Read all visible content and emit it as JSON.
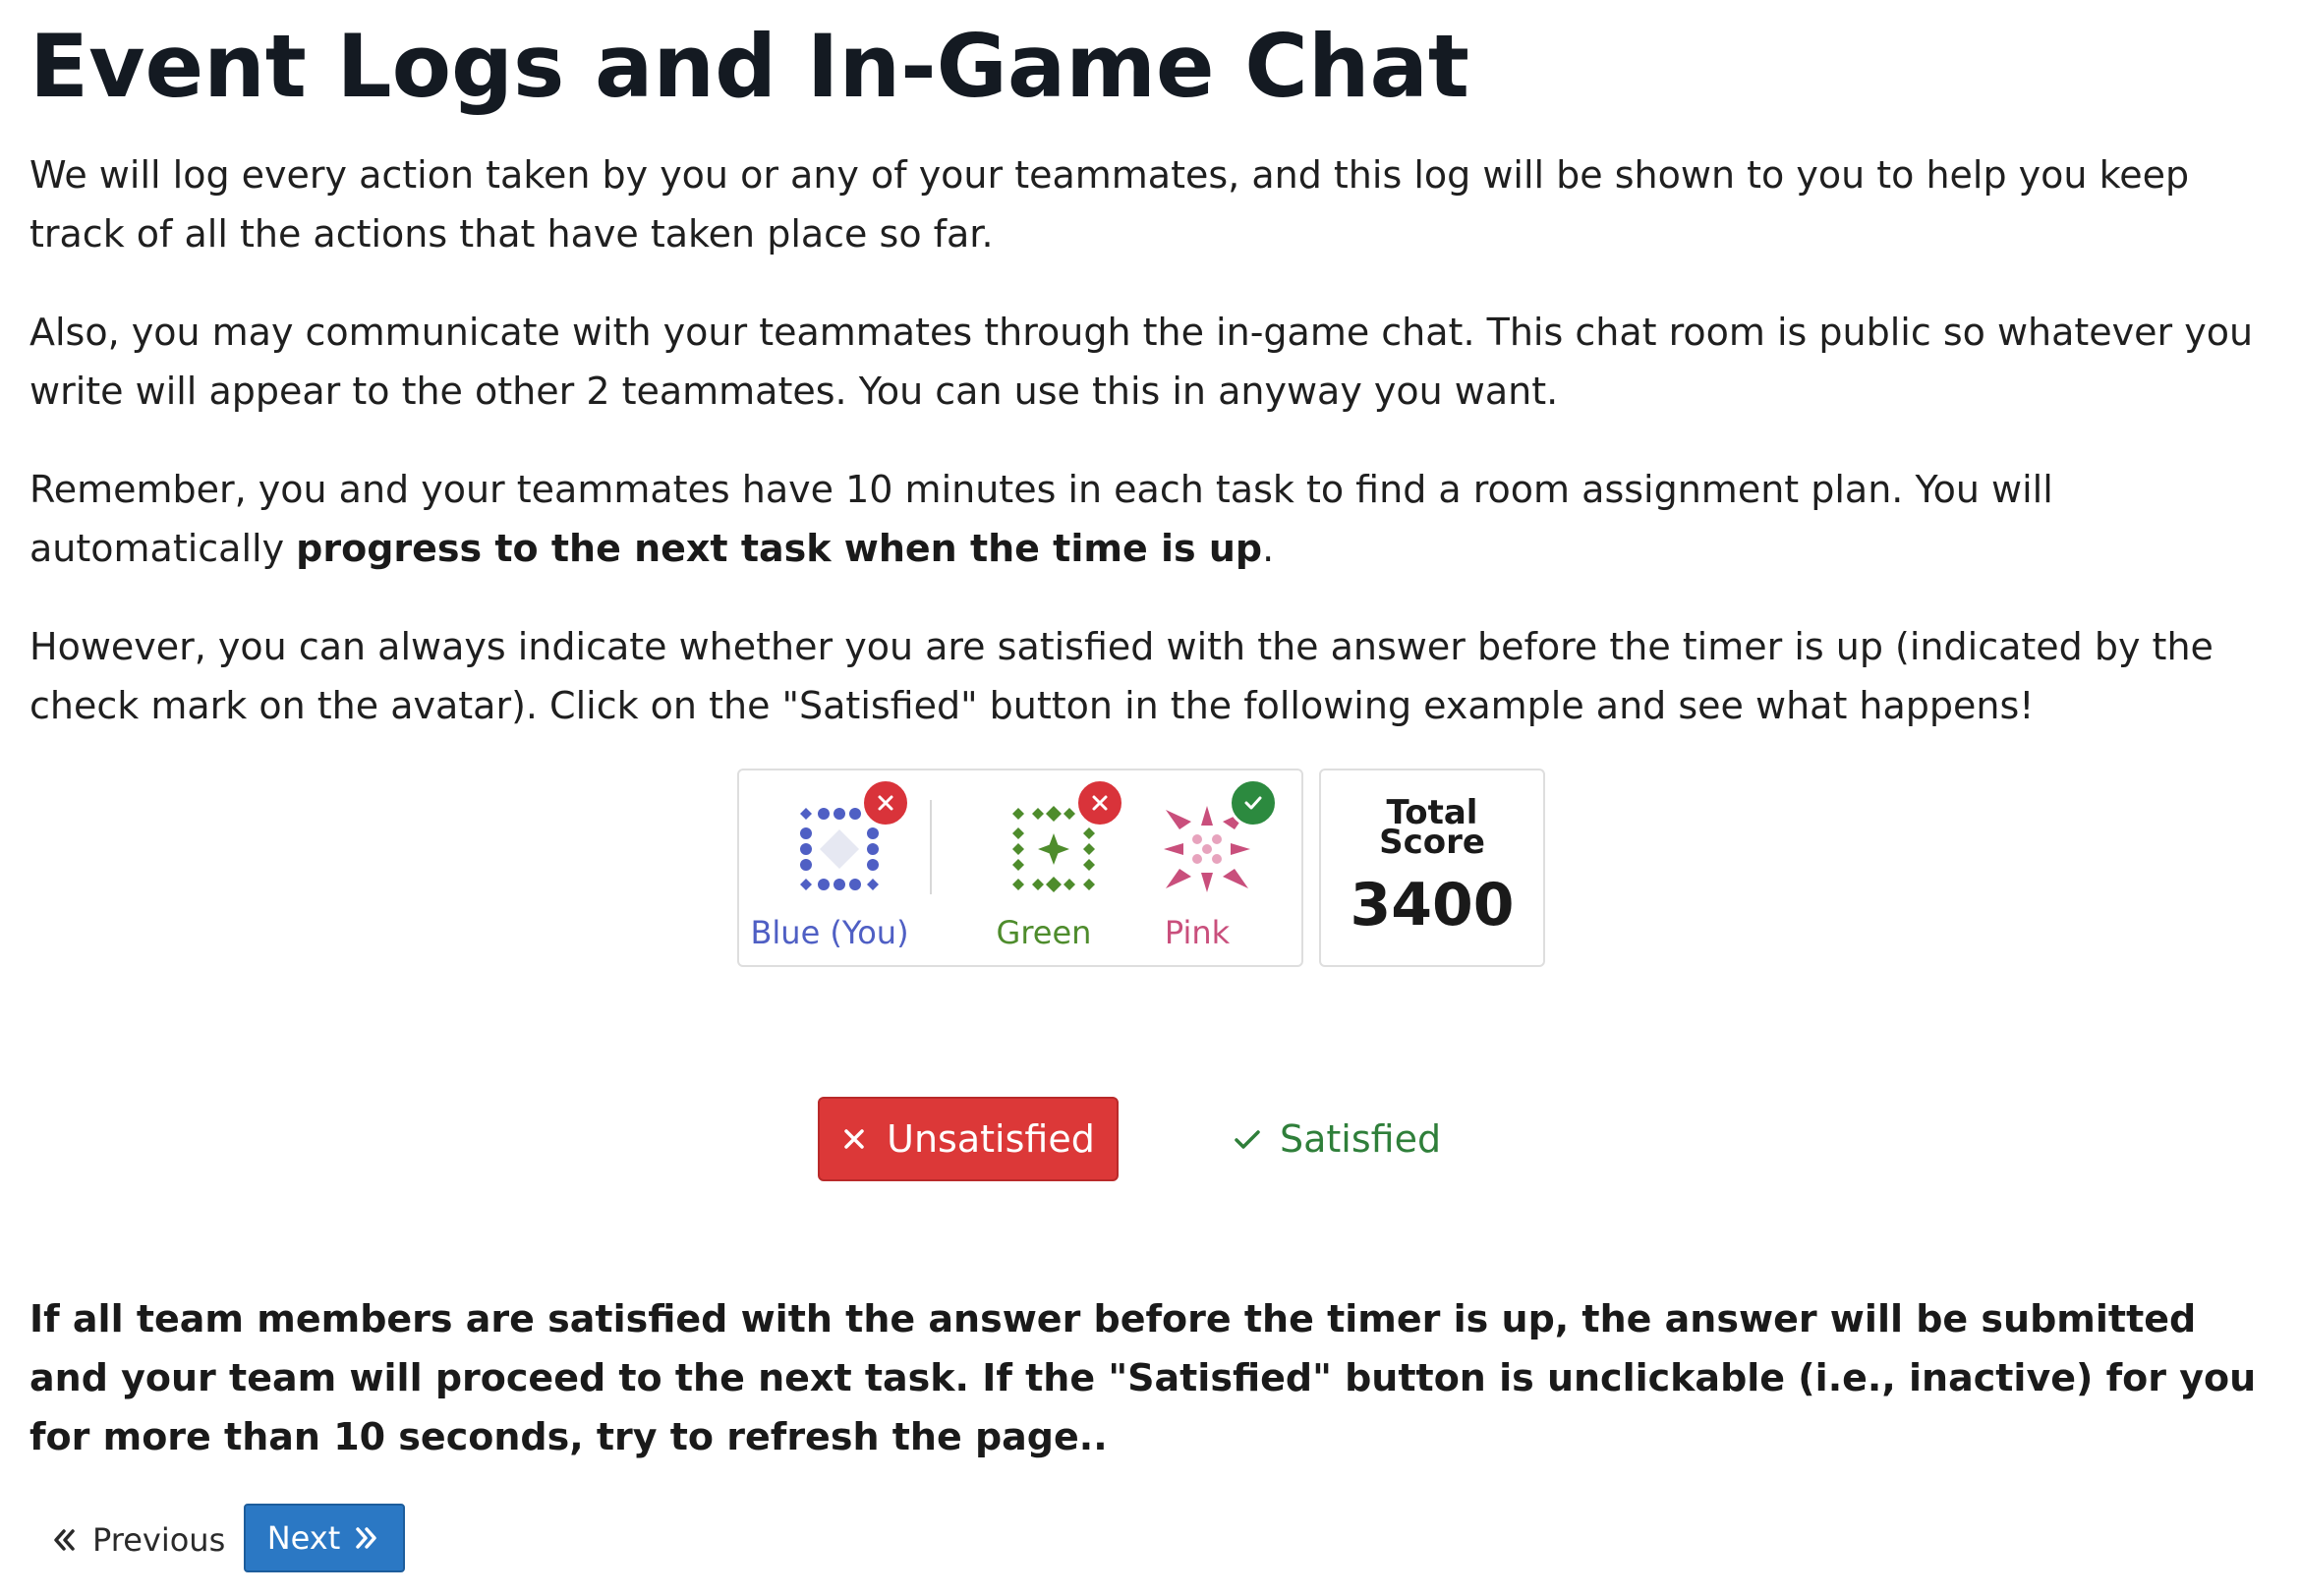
{
  "page": {
    "title": "Event Logs and In-Game Chat",
    "paragraph_1": "We will log every action taken by you or any of your teammates, and this log will be shown to you to help you keep track of all the actions that have taken place so far.",
    "paragraph_2": "Also, you may communicate with your teammates through the in-game chat. This chat room is public so whatever you write will appear to the other 2 teammates. You can use this in anyway you want.",
    "paragraph_3_start": "Remember, you and your teammates have 10 minutes in each task to find a room assignment plan. You will automatically ",
    "paragraph_3_bold": "progress to the next task when the time is up",
    "paragraph_3_end": ".",
    "paragraph_4": "However, you can always indicate whether you are satisfied with the answer before the timer is up (indicated by the check mark on the avatar). Click on the \"Satisfied\" button in the following example and see what happens!",
    "paragraph_5": "If all team members are satisfied with the answer before the timer is up, the answer will be submitted and your team will proceed to the next task. If the \"Satisfied\" button is unclickable (i.e., inactive) for you for more than 10 seconds, try to refresh the page.."
  },
  "team": {
    "members": [
      {
        "name": "Blue (You)",
        "color": "#4f5fc4",
        "status": "unsatisfied",
        "status_icon": "close-icon"
      },
      {
        "name": "Green",
        "color": "#4e8c2c",
        "status": "unsatisfied",
        "status_icon": "close-icon"
      },
      {
        "name": "Pink",
        "color": "#c94f7c",
        "status": "satisfied",
        "status_icon": "check-icon"
      }
    ]
  },
  "score": {
    "label": "Total Score",
    "value": "3400"
  },
  "buttons": {
    "unsatisfied_label": "Unsatisfied",
    "satisfied_label": "Satisfied"
  },
  "nav": {
    "previous_label": "Previous",
    "next_label": "Next"
  },
  "colors": {
    "unsatisfied_red": "#dc3838",
    "satisfied_green": "#2f7f3a",
    "next_blue": "#2b78c4"
  }
}
